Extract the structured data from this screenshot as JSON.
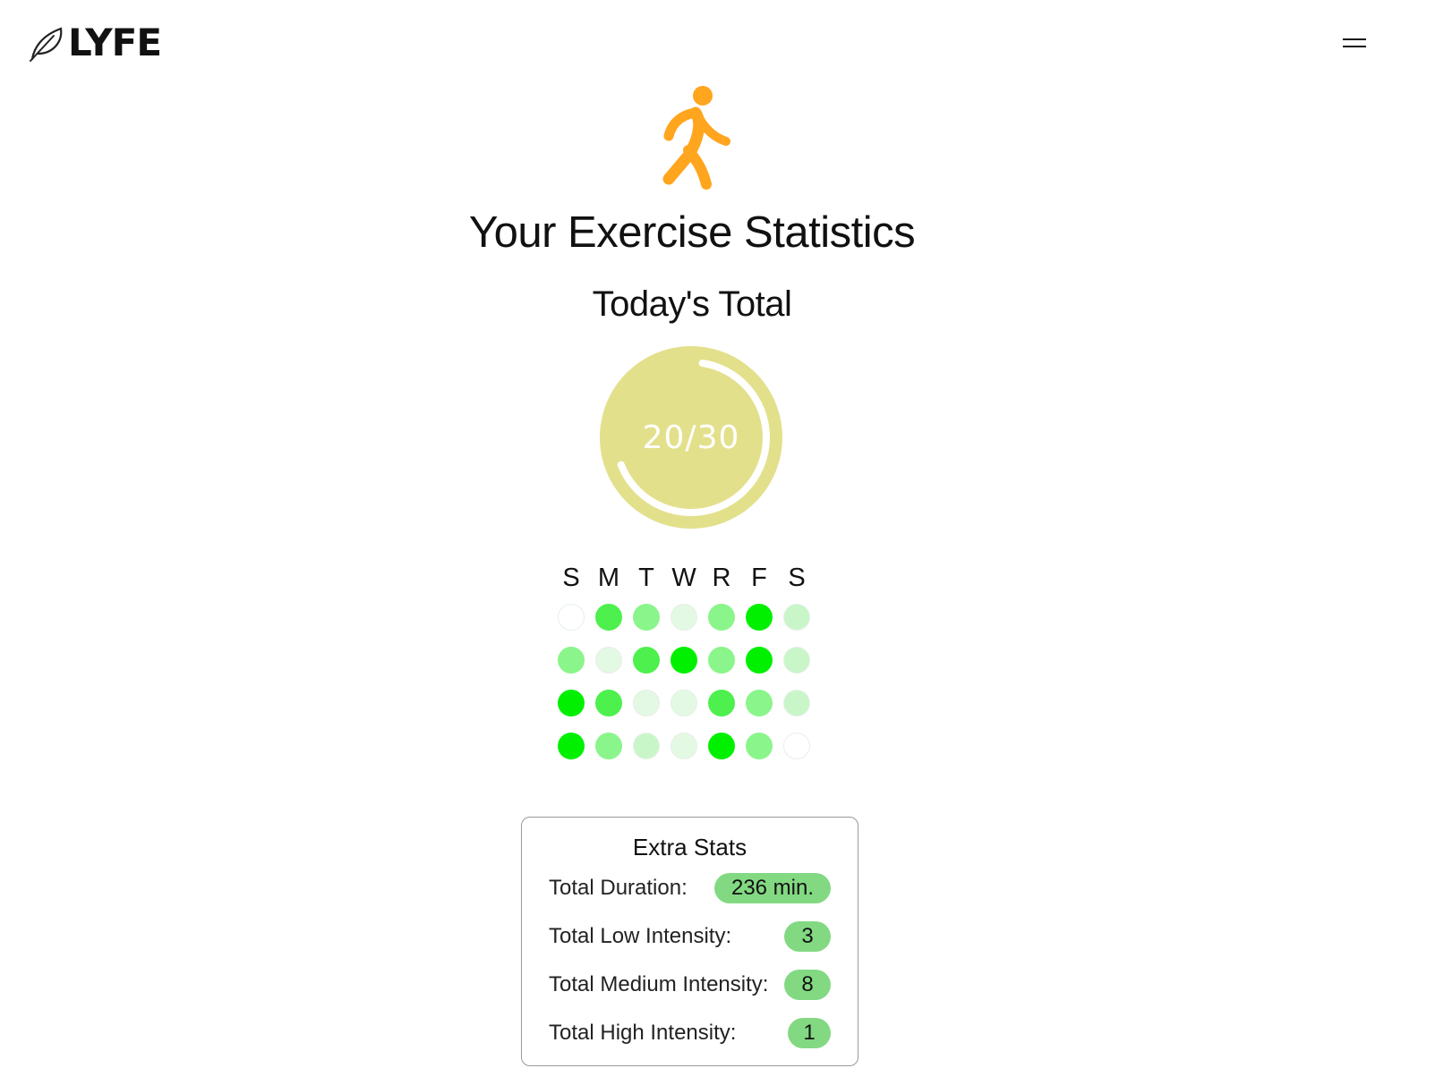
{
  "header": {
    "brand": "LYFE",
    "logo_icon": "leaf-icon",
    "menu_icon": "hamburger-menu-icon"
  },
  "hero": {
    "icon": "walking-person-icon",
    "icon_color": "#FFA51E",
    "title": "Your Exercise Statistics",
    "subtitle": "Today's Total"
  },
  "progress": {
    "current": 20,
    "goal": 30,
    "label": "20/30",
    "fraction": 0.667,
    "ring_color": "#E3E08C",
    "track_color": "#FFFFFF"
  },
  "week": {
    "day_labels": [
      "S",
      "M",
      "T",
      "W",
      "R",
      "F",
      "S"
    ],
    "levels_legend": {
      "0": "#FFFFFF",
      "1": "#E3F9E3",
      "2": "#C9F6C9",
      "3": "#8AF58A",
      "4": "#4DF04D",
      "5": "#00F000"
    },
    "rows": [
      [
        0,
        4,
        3,
        1,
        3,
        5,
        2
      ],
      [
        3,
        1,
        4,
        5,
        3,
        5,
        2
      ],
      [
        5,
        4,
        1,
        1,
        4,
        3,
        2
      ],
      [
        5,
        3,
        2,
        1,
        5,
        3,
        0
      ]
    ]
  },
  "extra_stats": {
    "title": "Extra Stats",
    "pill_color": "#82D982",
    "items": [
      {
        "label": "Total Duration:",
        "value": "236 min."
      },
      {
        "label": "Total Low Intensity:",
        "value": "3"
      },
      {
        "label": "Total Medium Intensity:",
        "value": "8"
      },
      {
        "label": "Total High Intensity:",
        "value": "1"
      }
    ]
  }
}
